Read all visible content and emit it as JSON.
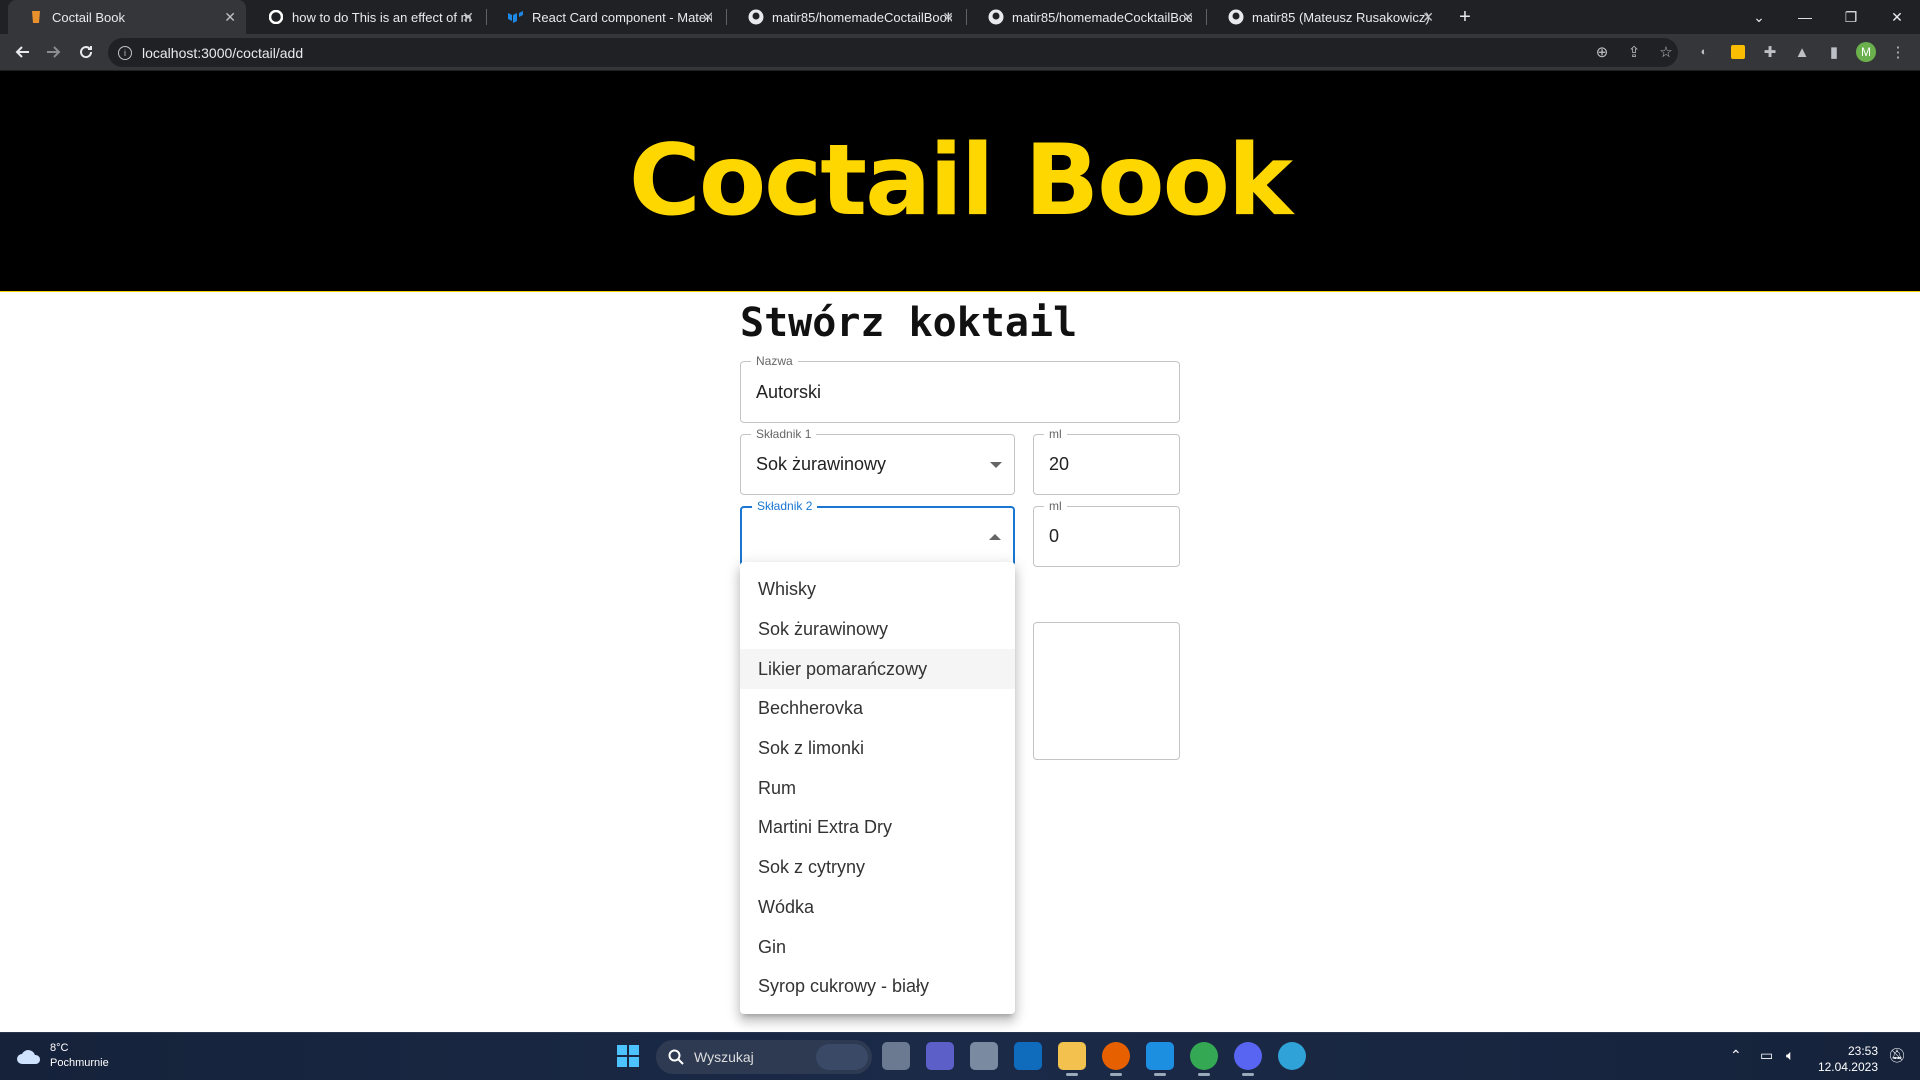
{
  "browser": {
    "tabs": [
      {
        "title": "Coctail Book",
        "favicon": "cocktail-favicon",
        "active": true
      },
      {
        "title": "how to do This is an effect of mu",
        "favicon": "google-icon",
        "active": false
      },
      {
        "title": "React Card component - Material",
        "favicon": "mui-icon",
        "active": false
      },
      {
        "title": "matir85/homemadeCoctailBook-",
        "favicon": "github-icon",
        "active": false
      },
      {
        "title": "matir85/homemadeCocktailBook",
        "favicon": "github-icon",
        "active": false
      },
      {
        "title": "matir85 (Mateusz Rusakowicz)",
        "favicon": "github-icon",
        "active": false
      }
    ],
    "new_tab": "+",
    "url": "localhost:3000/coctail/add",
    "profile_initial": "M"
  },
  "page": {
    "header_title": "Coctail Book",
    "form_title": "Stwórz koktail",
    "fields": {
      "name": {
        "label": "Nazwa",
        "value": "Autorski"
      },
      "ingredient1": {
        "label": "Składnik 1",
        "value": "Sok żurawinowy"
      },
      "ml1": {
        "label": "ml",
        "value": "20"
      },
      "ingredient2": {
        "label": "Składnik 2",
        "value": ""
      },
      "ml2": {
        "label": "ml",
        "value": "0"
      }
    },
    "dropdown_options": [
      "Whisky",
      "Sok żurawinowy",
      "Likier pomarańczowy",
      "Bechherovka",
      "Sok z limonki",
      "Rum",
      "Martini Extra Dry",
      "Sok z cytryny",
      "Wódka",
      "Gin",
      "Syrop cukrowy - biały"
    ],
    "hovered_option": "Likier pomarańczowy",
    "colors": {
      "header_bg": "#000000",
      "title_yellow": "#FFD700",
      "focus_blue": "#1976d2"
    }
  },
  "taskbar": {
    "weather_temp": "8°C",
    "weather_desc": "Pochmurnie",
    "search_placeholder": "Wyszukaj",
    "time": "23:53",
    "date": "12.04.2023"
  }
}
